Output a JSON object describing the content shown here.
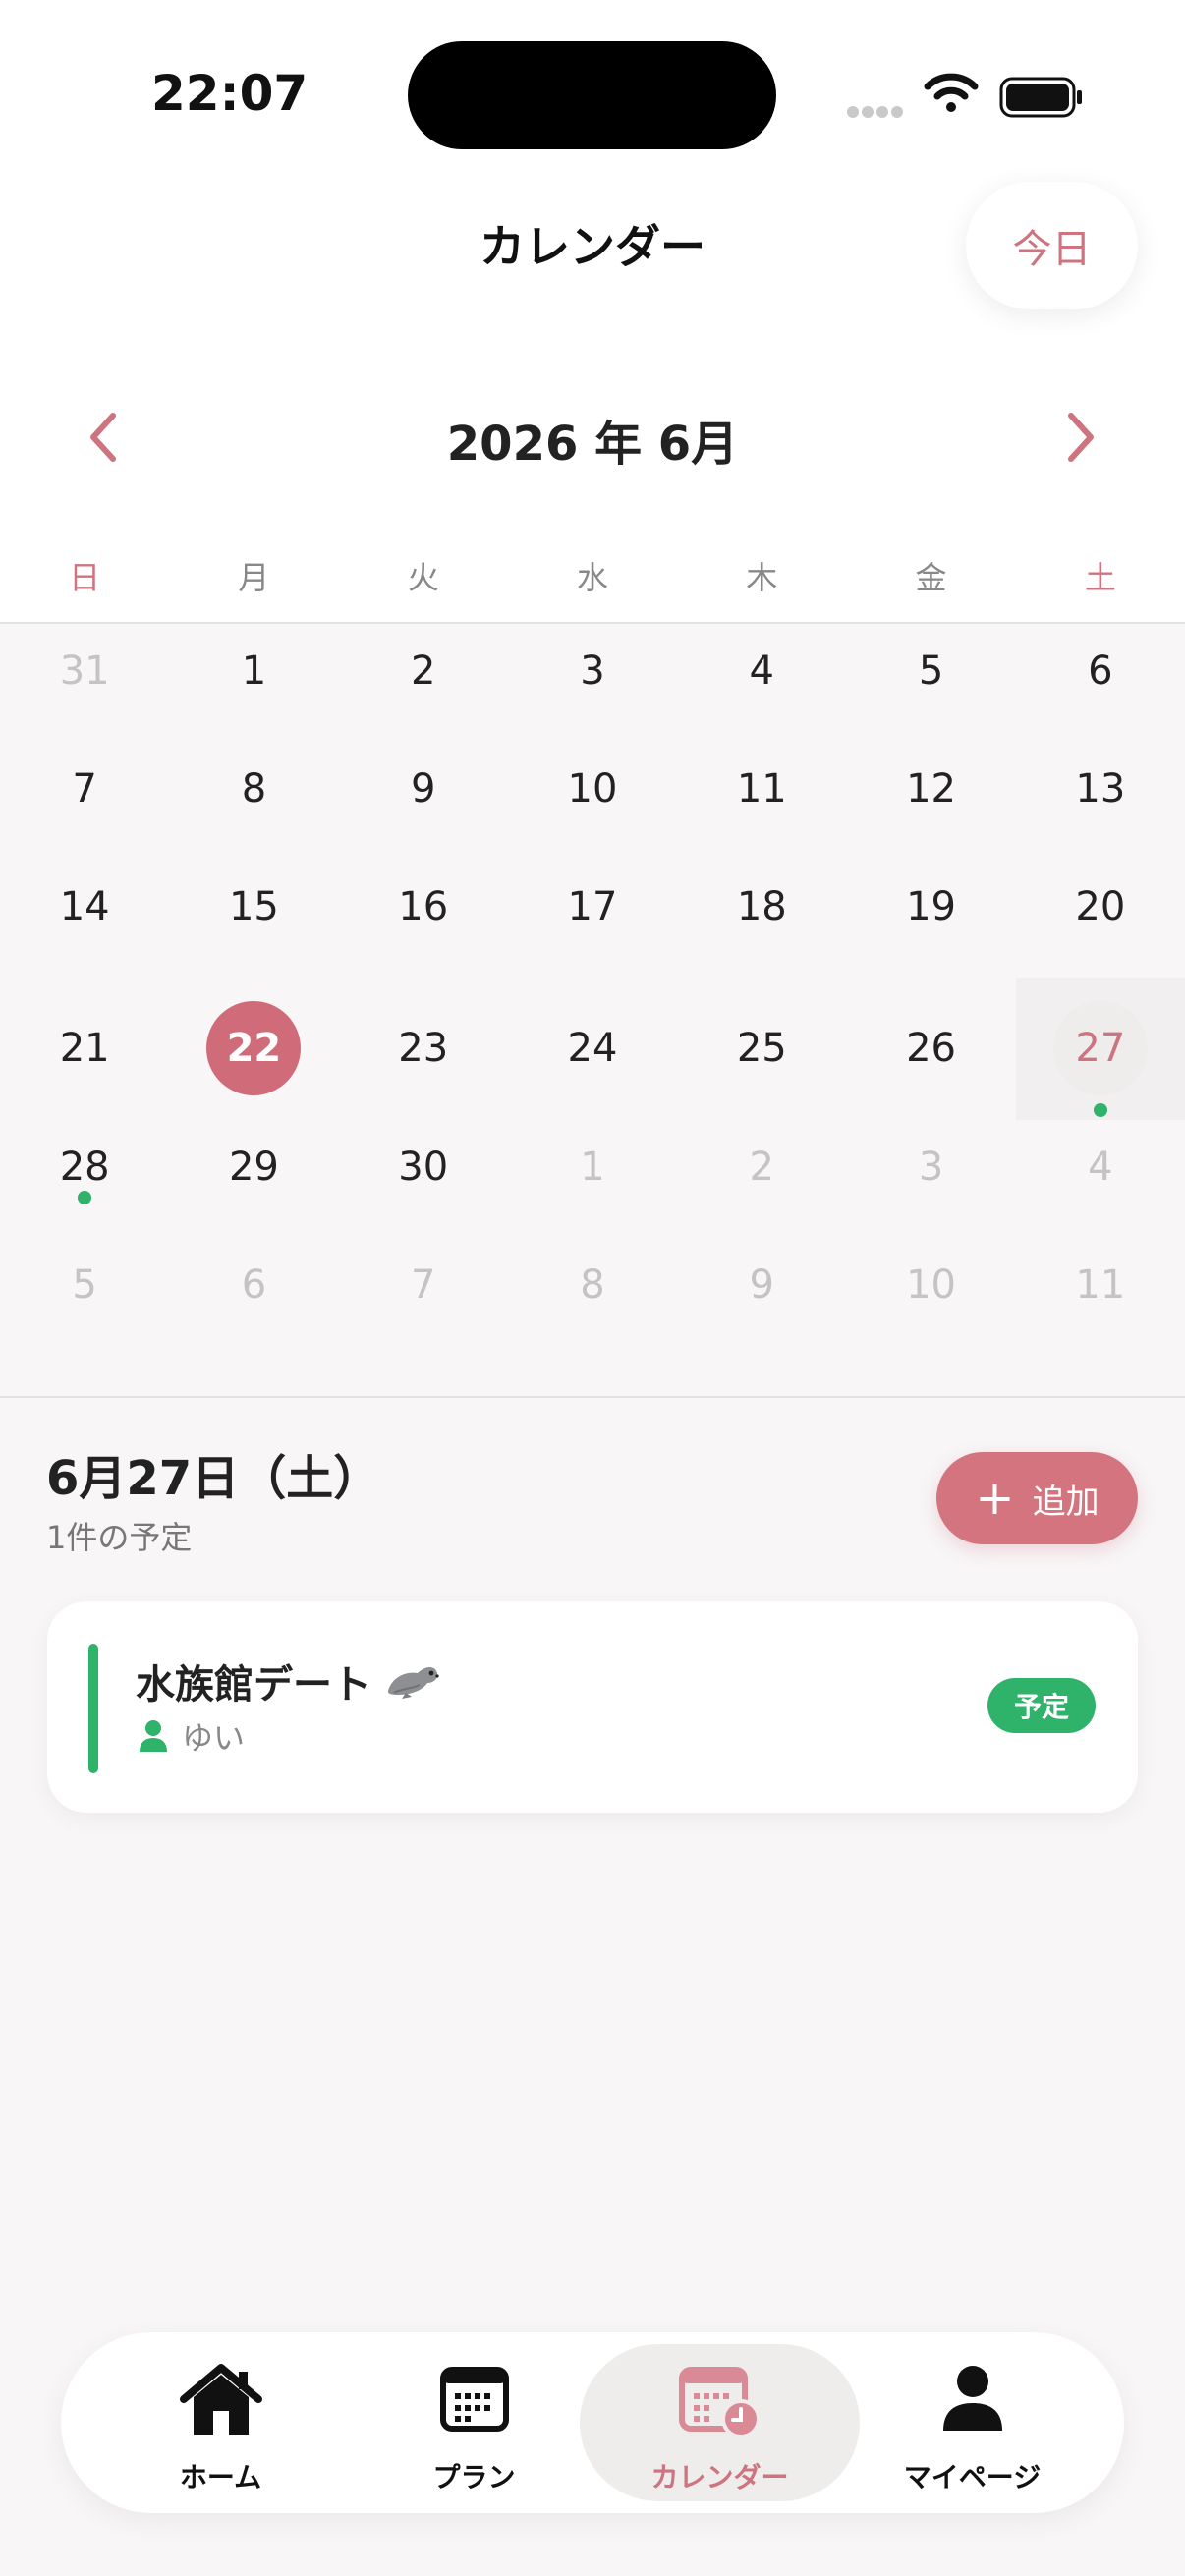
{
  "status_bar": {
    "time": "22:07"
  },
  "header": {
    "title": "カレンダー",
    "today_label": "今日"
  },
  "month_nav": {
    "title": "2026 年 6月"
  },
  "weekdays": [
    "日",
    "月",
    "火",
    "水",
    "木",
    "金",
    "土"
  ],
  "weeks": [
    [
      "31",
      "1",
      "2",
      "3",
      "4",
      "5",
      "6"
    ],
    [
      "7",
      "8",
      "9",
      "10",
      "11",
      "12",
      "13"
    ],
    [
      "14",
      "15",
      "16",
      "17",
      "18",
      "19",
      "20"
    ],
    [
      "21",
      "22",
      "23",
      "24",
      "25",
      "26",
      "27"
    ],
    [
      "28",
      "29",
      "30",
      "1",
      "2",
      "3",
      "4"
    ],
    [
      "5",
      "6",
      "7",
      "8",
      "9",
      "10",
      "11"
    ]
  ],
  "selected_day": {
    "date_label": "6月27日（土）",
    "count_label": "1件の予定",
    "add_label": "追加"
  },
  "events": [
    {
      "title": "水族館デート",
      "owner": "ゆい",
      "status": "予定",
      "color": "#2fb36b"
    }
  ],
  "tabs": [
    {
      "label": "ホーム",
      "icon": "home-icon"
    },
    {
      "label": "プラン",
      "icon": "plan-calendar-icon"
    },
    {
      "label": "カレンダー",
      "icon": "calendar-clock-icon",
      "active": true
    },
    {
      "label": "マイページ",
      "icon": "person-icon"
    }
  ],
  "colors": {
    "accent": "#d06c79",
    "event_green": "#2fb36b"
  }
}
